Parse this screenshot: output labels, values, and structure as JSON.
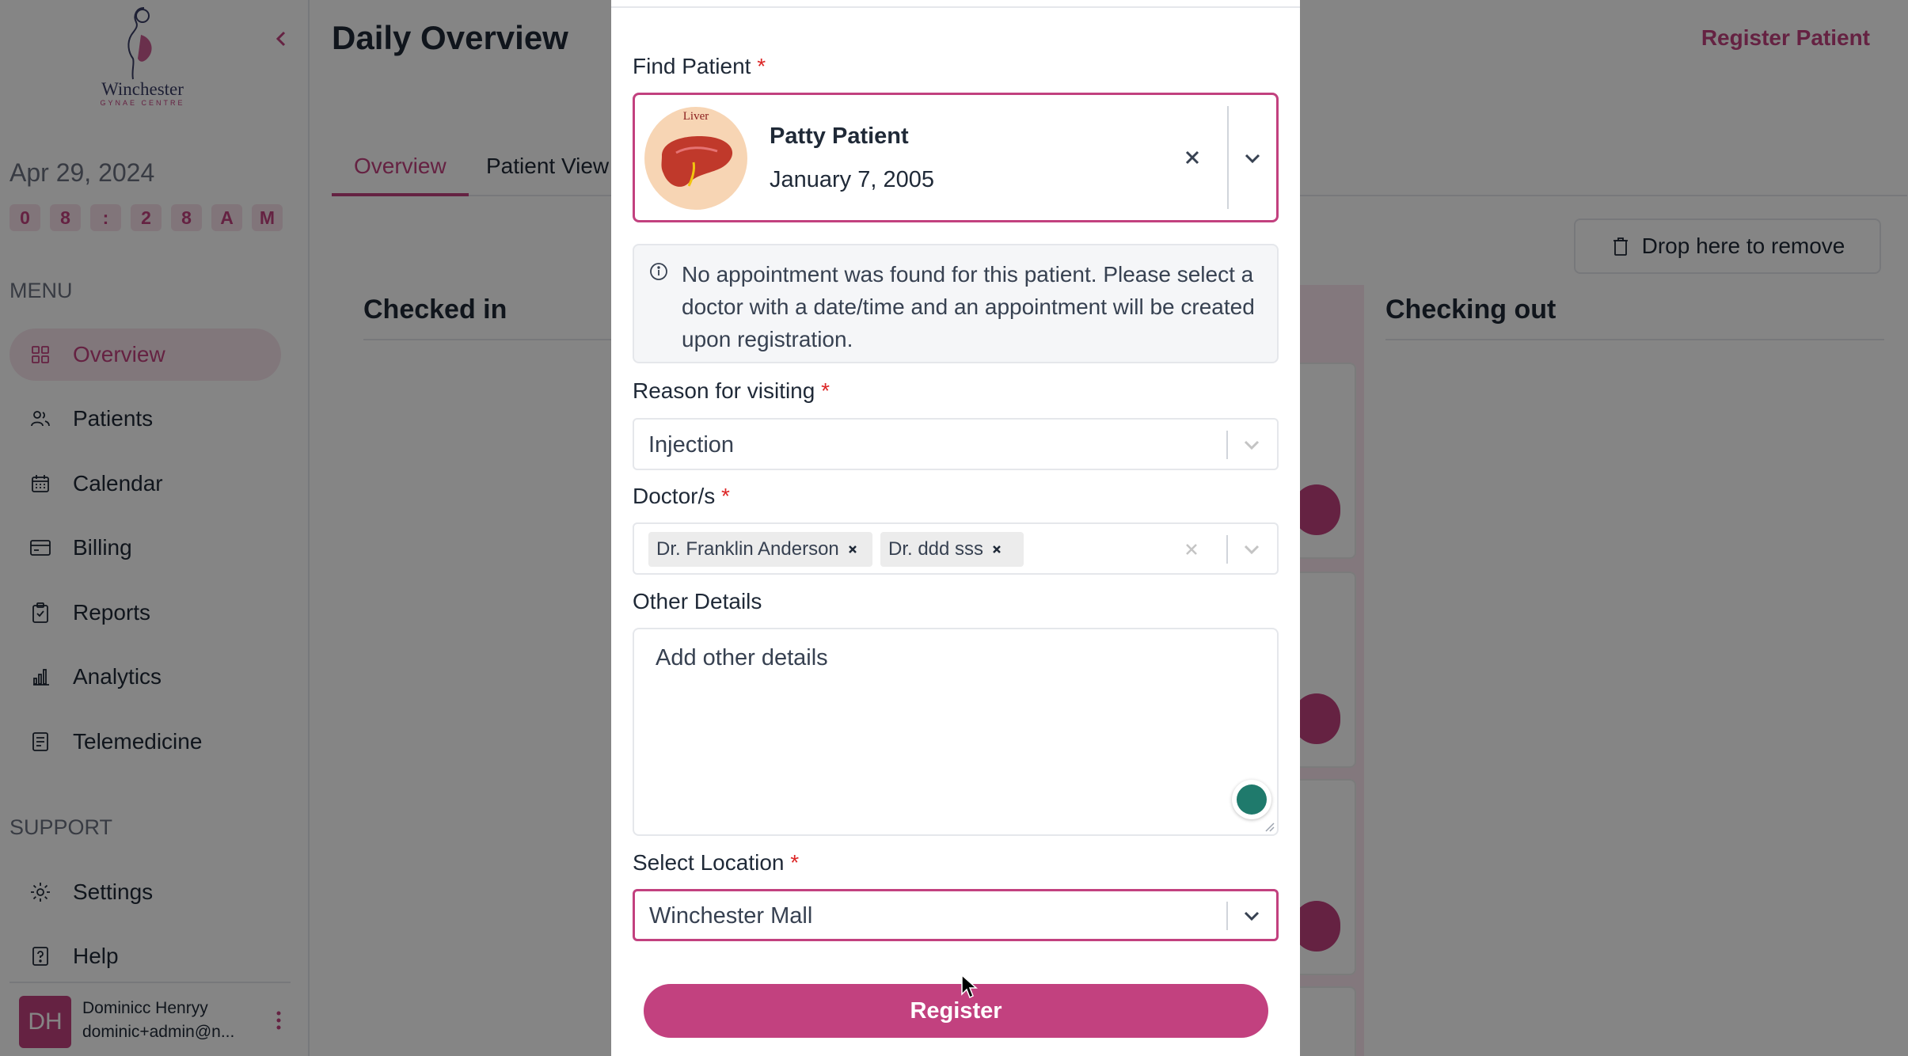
{
  "sidebar": {
    "logo_text": "Winchester",
    "logo_sub": "GYNAE CENTRE",
    "date": "Apr 29, 2024",
    "clock": [
      "0",
      "8",
      ":",
      "2",
      "8",
      "A",
      "M"
    ],
    "menu_heading": "MENU",
    "menu_items": [
      {
        "label": "Overview",
        "icon": "grid-icon",
        "active": true
      },
      {
        "label": "Patients",
        "icon": "users-icon"
      },
      {
        "label": "Calendar",
        "icon": "calendar-icon"
      },
      {
        "label": "Billing",
        "icon": "billing-icon"
      },
      {
        "label": "Reports",
        "icon": "clipboard-icon"
      },
      {
        "label": "Analytics",
        "icon": "bar-chart-icon"
      },
      {
        "label": "Telemedicine",
        "icon": "telemedicine-icon"
      }
    ],
    "support_heading": "SUPPORT",
    "support_items": [
      {
        "label": "Settings",
        "icon": "gear-icon"
      },
      {
        "label": "Help",
        "icon": "help-icon"
      }
    ],
    "user": {
      "initials": "DH",
      "name": "Dominicc Henryy",
      "email": "dominic+admin@n..."
    }
  },
  "main": {
    "title": "Daily Overview",
    "register_link": "Register Patient",
    "tabs": [
      {
        "label": "Overview",
        "active": true
      },
      {
        "label": "Patient View"
      }
    ],
    "drop_zone": "Drop here to remove",
    "columns": {
      "checked_in": "Checked in",
      "checking_out": "Checking out"
    }
  },
  "modal": {
    "find_patient_label": "Find Patient",
    "required_mark": "*",
    "patient": {
      "name": "Patty Patient",
      "dob": "January 7, 2005",
      "avatar_caption": "Liver"
    },
    "info_message": "No appointment was found for this patient. Please select a doctor with a date/time and an appointment will be created upon registration.",
    "reason_label": "Reason for visiting",
    "reason_value": "Injection",
    "doctors_label": "Doctor/s",
    "doctors": [
      "Dr. Franklin Anderson",
      "Dr. ddd sss"
    ],
    "other_details_label": "Other Details",
    "other_details_placeholder": "Add other details",
    "location_label": "Select Location",
    "location_value": "Winchester Mall",
    "register_button": "Register"
  },
  "colors": {
    "accent": "#c2417f",
    "accent_light": "#f7e4ec",
    "required": "#dc2626",
    "grammar_badge": "#1f7a6c"
  }
}
